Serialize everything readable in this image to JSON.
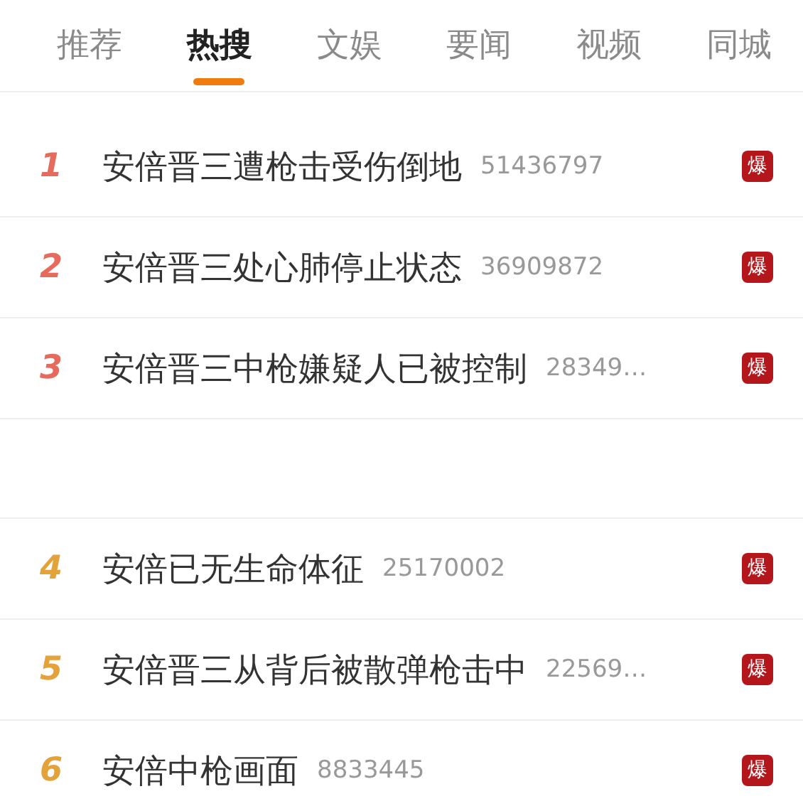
{
  "tabs": [
    {
      "label": "推荐",
      "selected": false
    },
    {
      "label": "热搜",
      "selected": true
    },
    {
      "label": "文娱",
      "selected": false
    },
    {
      "label": "要闻",
      "selected": false
    },
    {
      "label": "视频",
      "selected": false
    },
    {
      "label": "同城",
      "selected": false
    }
  ],
  "items": [
    {
      "kind": "topic",
      "rank": "1",
      "color": "#e56b5d",
      "title": "安倍晋三遭枪击受伤倒地",
      "count": "51436797",
      "badge": "爆"
    },
    {
      "kind": "topic",
      "rank": "2",
      "color": "#e56b5d",
      "title": "安倍晋三处心肺停止状态",
      "count": "36909872",
      "badge": "爆"
    },
    {
      "kind": "topic",
      "rank": "3",
      "color": "#e56b5d",
      "title": "安倍晋三中枪嫌疑人已被控制",
      "count": "28349…",
      "badge": "爆"
    },
    {
      "kind": "blank"
    },
    {
      "kind": "topic",
      "rank": "4",
      "color": "#e3a23a",
      "title": "安倍已无生命体征",
      "count": "25170002",
      "badge": "爆"
    },
    {
      "kind": "topic",
      "rank": "5",
      "color": "#e3a23a",
      "title": "安倍晋三从背后被散弹枪击中",
      "count": "22569…",
      "badge": "爆"
    },
    {
      "kind": "topic",
      "rank": "6",
      "color": "#e3a23a",
      "title": "安倍中枪画面",
      "count": "8833445",
      "badge": "爆"
    }
  ]
}
